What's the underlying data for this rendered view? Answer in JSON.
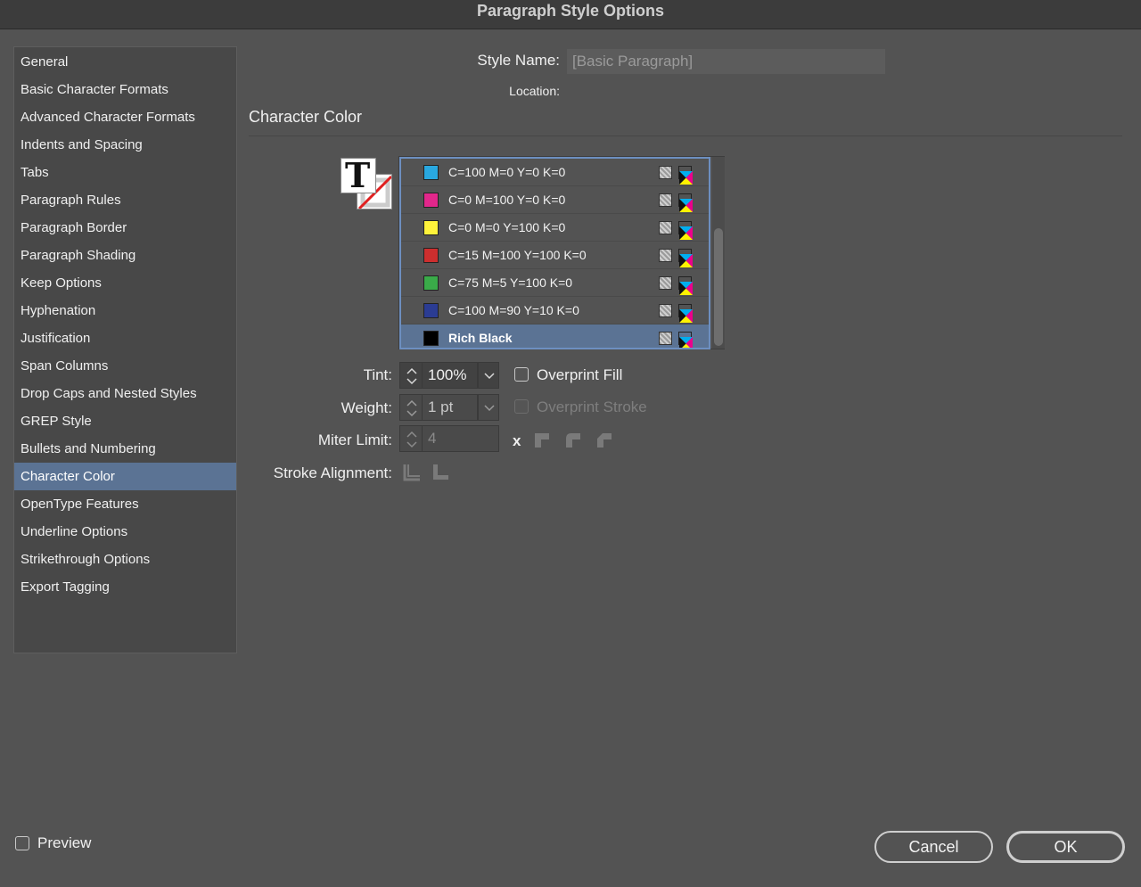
{
  "dialog": {
    "title": "Paragraph Style Options"
  },
  "sidebar": {
    "items": [
      {
        "label": "General"
      },
      {
        "label": "Basic Character Formats"
      },
      {
        "label": "Advanced Character Formats"
      },
      {
        "label": "Indents and Spacing"
      },
      {
        "label": "Tabs"
      },
      {
        "label": "Paragraph Rules"
      },
      {
        "label": "Paragraph Border"
      },
      {
        "label": "Paragraph Shading"
      },
      {
        "label": "Keep Options"
      },
      {
        "label": "Hyphenation"
      },
      {
        "label": "Justification"
      },
      {
        "label": "Span Columns"
      },
      {
        "label": "Drop Caps and Nested Styles"
      },
      {
        "label": "GREP Style"
      },
      {
        "label": "Bullets and Numbering"
      },
      {
        "label": "Character Color"
      },
      {
        "label": "OpenType Features"
      },
      {
        "label": "Underline Options"
      },
      {
        "label": "Strikethrough Options"
      },
      {
        "label": "Export Tagging"
      }
    ],
    "selected_index": 15
  },
  "header": {
    "style_name_label": "Style Name:",
    "style_name_value": "[Basic Paragraph]",
    "location_label": "Location:"
  },
  "section": {
    "title": "Character Color"
  },
  "fill_stroke": {
    "fill_glyph": "T"
  },
  "swatches": [
    {
      "name": "C=100 M=0 Y=0 K=0",
      "color": "#29a8e0"
    },
    {
      "name": "C=0 M=100 Y=0 K=0",
      "color": "#e2278b"
    },
    {
      "name": "C=0 M=0 Y=100 K=0",
      "color": "#fff33b"
    },
    {
      "name": "C=15 M=100 Y=100 K=0",
      "color": "#cd2e2e"
    },
    {
      "name": "C=75 M=5 Y=100 K=0",
      "color": "#3aaa49"
    },
    {
      "name": "C=100 M=90 Y=10 K=0",
      "color": "#2b3c93"
    },
    {
      "name": "Rich Black",
      "color": "#000000"
    }
  ],
  "selected_swatch_index": 6,
  "fields": {
    "tint_label": "Tint:",
    "tint_value": "100%",
    "weight_label": "Weight:",
    "weight_value": "1 pt",
    "miter_label": "Miter Limit:",
    "miter_value": "4",
    "miter_x": "x",
    "stroke_align_label": "Stroke Alignment:"
  },
  "checkboxes": {
    "overprint_fill": "Overprint Fill",
    "overprint_stroke": "Overprint Stroke",
    "preview": "Preview"
  },
  "buttons": {
    "cancel": "Cancel",
    "ok": "OK"
  }
}
